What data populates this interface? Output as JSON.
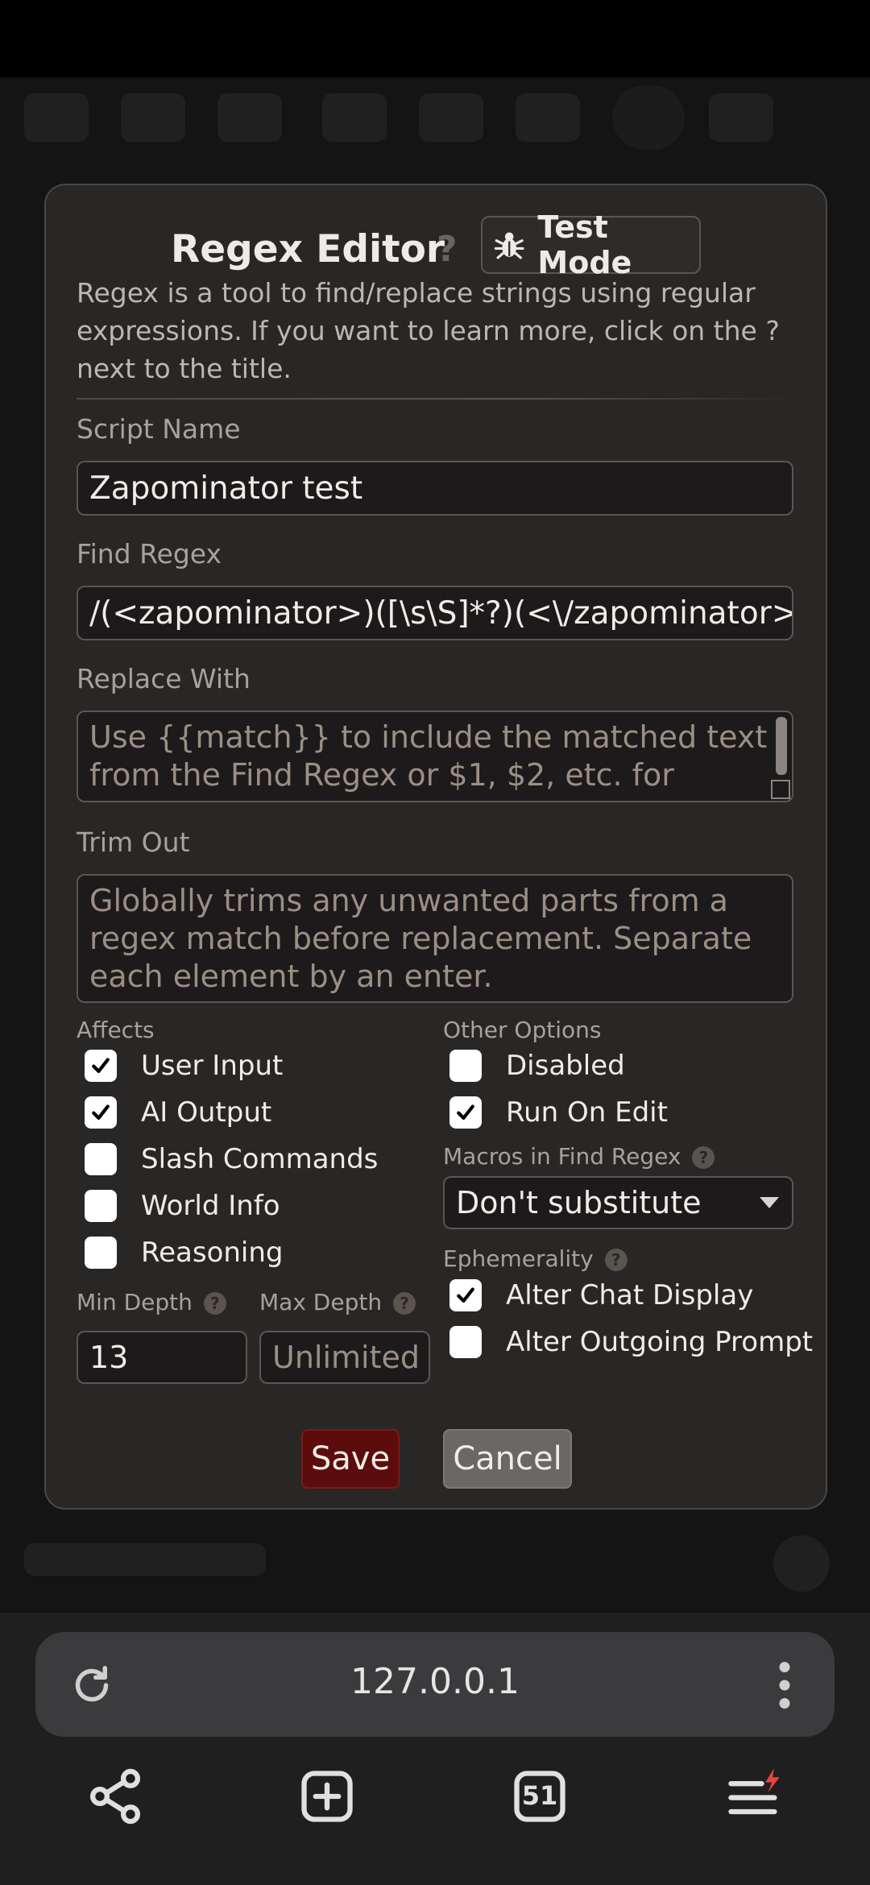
{
  "dialog": {
    "title": "Regex Editor",
    "help_glyph": "?",
    "test_mode_label": "Test Mode",
    "description": "Regex is a tool to find/replace strings using regular expressions. If you want to learn more, click on the ? next to the title."
  },
  "fields": {
    "script_name_label": "Script Name",
    "script_name_value": "Zapominator test",
    "find_regex_label": "Find Regex",
    "find_regex_value": "/(<zapominator>)([\\s\\S]*?)(<\\/zapominator>)/g",
    "replace_label": "Replace With",
    "replace_placeholder": "Use {{match}} to include the matched text from the Find Regex or $1, $2, etc. for",
    "trim_label": "Trim Out",
    "trim_placeholder": "Globally trims any unwanted parts from a regex match before replacement. Separate each element by an enter."
  },
  "affects": {
    "heading": "Affects",
    "items": [
      {
        "label": "User Input",
        "checked": true
      },
      {
        "label": "AI Output",
        "checked": true
      },
      {
        "label": "Slash Commands",
        "checked": false
      },
      {
        "label": "World Info",
        "checked": false
      },
      {
        "label": "Reasoning",
        "checked": false
      }
    ]
  },
  "other_options": {
    "heading": "Other Options",
    "items": [
      {
        "label": "Disabled",
        "checked": false
      },
      {
        "label": "Run On Edit",
        "checked": true
      }
    ]
  },
  "macros": {
    "label": "Macros in Find Regex",
    "selected": "Don't substitute"
  },
  "ephemerality": {
    "heading": "Ephemerality",
    "items": [
      {
        "label": "Alter Chat Display",
        "checked": true
      },
      {
        "label": "Alter Outgoing Prompt",
        "checked": false
      }
    ]
  },
  "depth": {
    "min_label": "Min Depth",
    "min_value": "13",
    "max_label": "Max Depth",
    "max_placeholder": "Unlimited"
  },
  "buttons": {
    "save": "Save",
    "cancel": "Cancel"
  },
  "browser": {
    "url": "127.0.0.1",
    "tab_count": "51"
  },
  "colors": {
    "dialog_bg": "#292626",
    "save_bg": "#5c0c0c",
    "cancel_bg": "#6a6866",
    "notification_badge": "#e5453a"
  }
}
